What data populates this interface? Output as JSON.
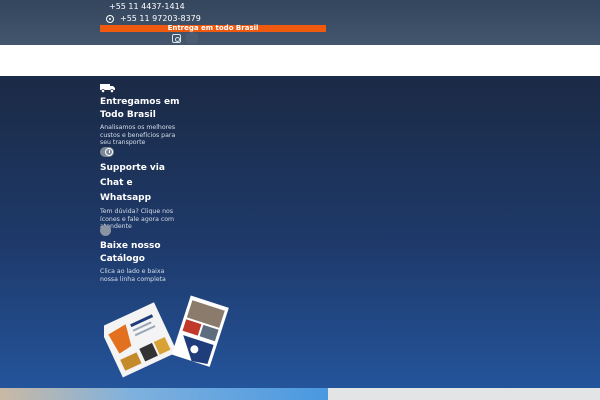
{
  "header": {
    "phone": "+55 11 4437-1414",
    "whatsapp": "+55 11 97203-8379",
    "banner": "Entrega em todo Brasil"
  },
  "features": [
    {
      "title": "Entregamos em Todo Brasil",
      "text": "Analisamos os melhores custos e benefícios para seu transporte",
      "icon": "truck-icon"
    },
    {
      "title": "Supporte via Chat e Whatsapp",
      "text": "Tem dúvida? Clique nos ícones e fale agora com atendente",
      "icon": "clock-icon"
    },
    {
      "title": "Baixe nosso Catálogo",
      "text": "Clica ao lado e baixa nossa linha completa",
      "icon": "download-icon"
    }
  ],
  "colors": {
    "accent": "#f05a0f",
    "topbar": "#3b4d63",
    "main_dark": "#1b2a45",
    "main_light": "#24549b"
  }
}
